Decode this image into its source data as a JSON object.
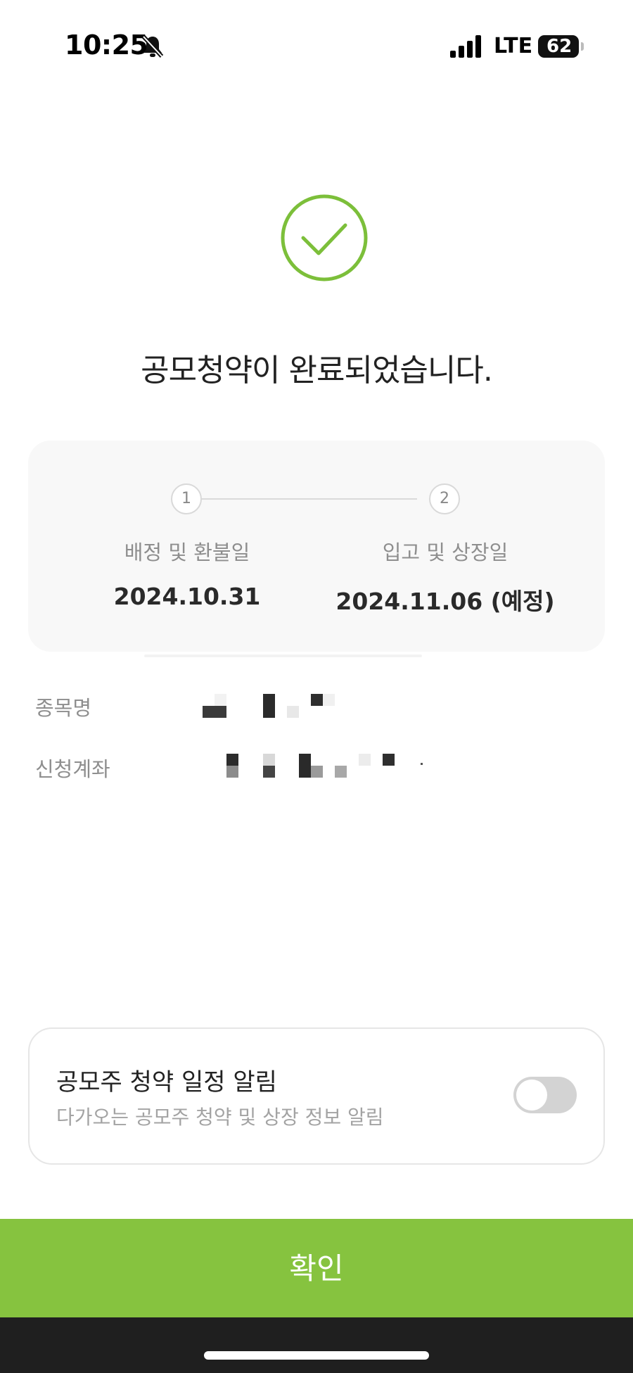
{
  "status_bar": {
    "time": "10:25",
    "network": "LTE",
    "battery": "62",
    "icons": [
      "bell-off-icon",
      "signal-icon"
    ]
  },
  "success": {
    "icon": "check-circle-icon",
    "title": "공모청약이 완료되었습니다."
  },
  "schedule": {
    "steps": [
      {
        "number": "1",
        "label": "배정 및 환불일",
        "date": "2024.10.31"
      },
      {
        "number": "2",
        "label": "입고 및 상장일",
        "date": "2024.11.06 (예정)"
      }
    ]
  },
  "details": [
    {
      "label": "종목명"
    },
    {
      "label": "신청계좌"
    }
  ],
  "alert": {
    "title": "공모주 청약 일정 알림",
    "subtitle": "다가오는 공모주 청약 및 상장 정보 알림",
    "toggle_on": false
  },
  "confirm_label": "확인",
  "colors": {
    "accent": "#86c33f",
    "check": "#7cbf3a"
  }
}
